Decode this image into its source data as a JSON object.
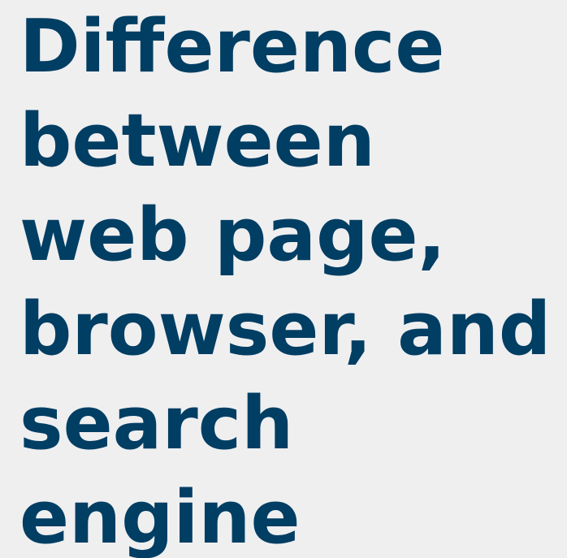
{
  "title": {
    "lines": [
      "Difference",
      "between",
      "web page,",
      "browser, and",
      "search",
      "engine"
    ]
  },
  "colors": {
    "background": "#efeff0",
    "title_text": "#013e63"
  }
}
